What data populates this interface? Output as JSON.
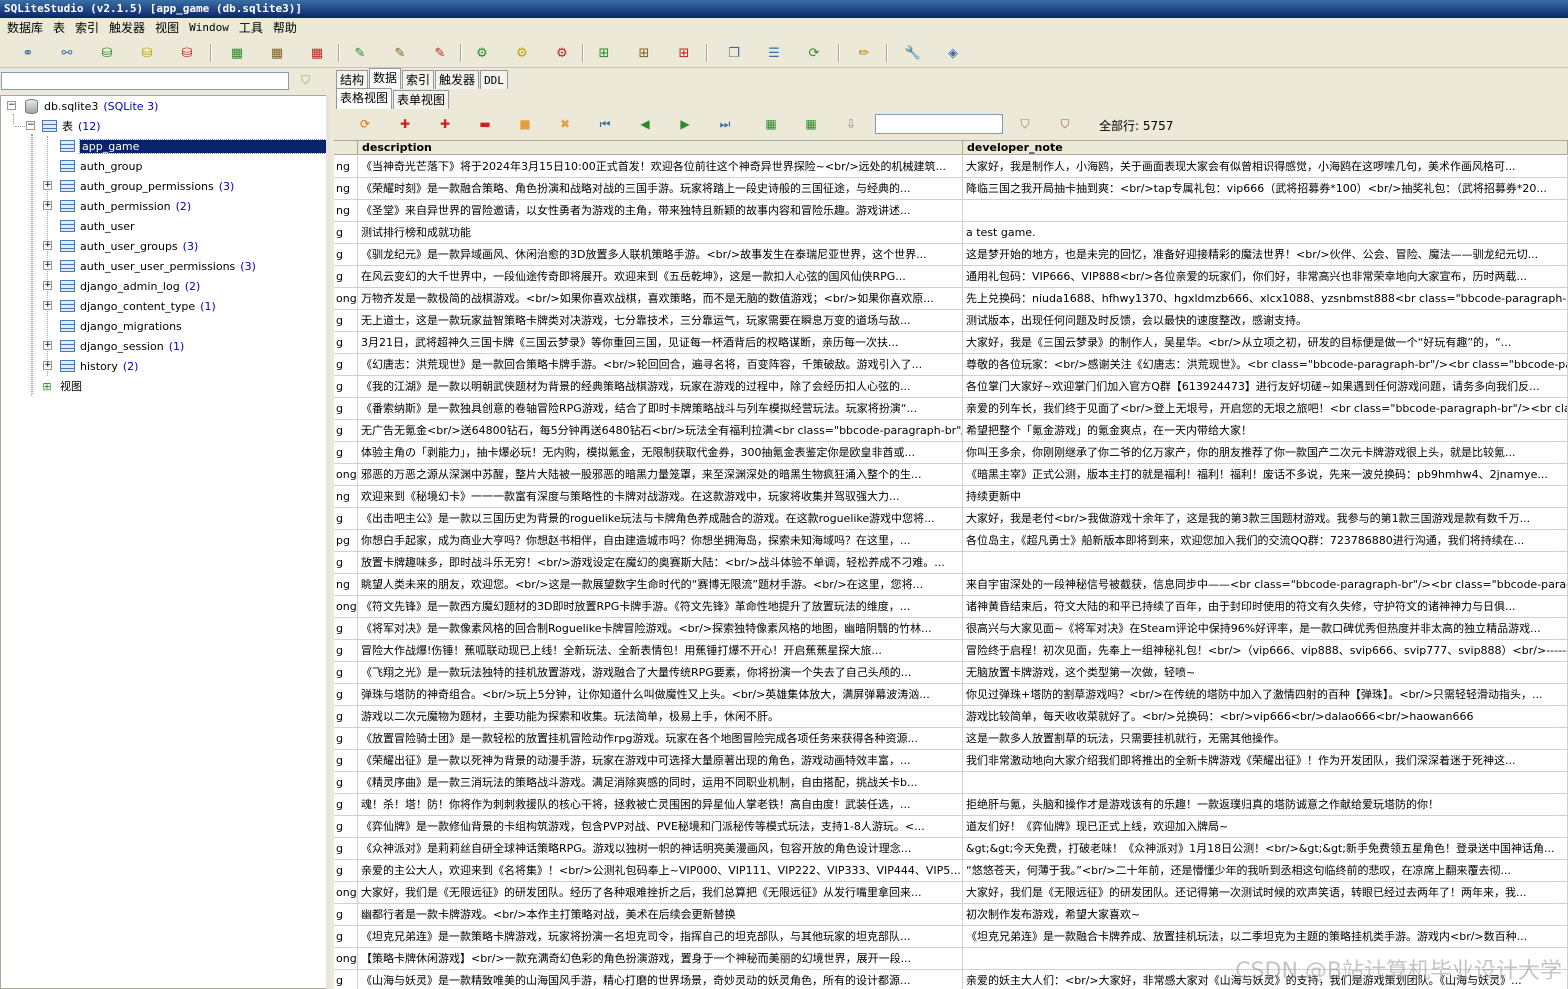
{
  "window": {
    "title": "SQLiteStudio (v2.1.5) [app_game (db.sqlite3)]"
  },
  "menu": [
    "数据库",
    "表",
    "索引",
    "触发器",
    "视图",
    "Window",
    "工具",
    "帮助"
  ],
  "tree": {
    "database": {
      "name": "db.sqlite3",
      "type": "(SQLite 3)"
    },
    "tables_group": {
      "label": "表",
      "count": "(12)"
    },
    "tables": [
      {
        "name": "app_game",
        "count": ""
      },
      {
        "name": "auth_group",
        "count": ""
      },
      {
        "name": "auth_group_permissions",
        "count": "(3)"
      },
      {
        "name": "auth_permission",
        "count": "(2)"
      },
      {
        "name": "auth_user",
        "count": ""
      },
      {
        "name": "auth_user_groups",
        "count": "(3)"
      },
      {
        "name": "auth_user_user_permissions",
        "count": "(3)"
      },
      {
        "name": "django_admin_log",
        "count": "(2)"
      },
      {
        "name": "django_content_type",
        "count": "(1)"
      },
      {
        "name": "django_migrations",
        "count": ""
      },
      {
        "name": "django_session",
        "count": "(1)"
      },
      {
        "name": "history",
        "count": "(2)"
      }
    ],
    "views_label": "视图"
  },
  "tabs": [
    "结构",
    "数据",
    "索引",
    "触发器",
    "DDL"
  ],
  "subtabs": [
    "表格视图",
    "表单视图"
  ],
  "total_rows_label": "全部行:",
  "total_rows": "5757",
  "columns": [
    "description",
    "developer_note"
  ],
  "rows": [
    [
      "ng",
      "《当神奇光芒落下》将于2024年3月15日10:00正式首发！欢迎各位前往这个神奇异世界探险~<br/>远处的机械建筑...",
      "大家好，我是制作人，小海鸥，关于画面表现大家会有似曾相识得感觉，小海鸥在这啰嗦几句，美术作画风格可..."
    ],
    [
      "ng",
      "《荣耀时刻》是一款融合策略、角色扮演和战略对战的三国手游。玩家将踏上一段史诗般的三国征途，与经典的...",
      "降临三国之我开局抽卡抽到爽：<br/>tap专属礼包：vip666（武将招募券*100）<br/>抽奖礼包：（武将招募券*20..."
    ],
    [
      "ng",
      "《圣堂》来自异世界的冒险邀请，以女性勇者为游戏的主角，带来独特且新颖的故事内容和冒险乐趣。游戏讲述...",
      ""
    ],
    [
      "g",
      "测试排行榜和成就功能",
      "a test game."
    ],
    [
      "g",
      "《驯龙纪元》是一款异域画风、休闲治愈的3D放置多人联机策略手游。<br/>故事发生在泰瑞尼亚世界，这个世界...",
      "这是梦开始的地方，也是未完的回忆，准备好迎接精彩的魔法世界！<br/>伙伴、公会、冒险、魔法——驯龙纪元切..."
    ],
    [
      "g",
      "在风云变幻的大千世界中，一段仙途传奇即将展开。欢迎来到《五岳乾坤》，这是一款扣人心弦的国风仙侠RPG...",
      "通用礼包码：VIP666、VIP888<br/>各位亲爱的玩家们，你们好，非常高兴也非常荣幸地向大家宣布，历时两载..."
    ],
    [
      "ong",
      "万物齐发是一款极简的战棋游戏。<br/>如果你喜欢战棋，喜欢策略，而不是无脑的数值游戏；<br/>如果你喜欢原...",
      "先上兑换码：niuda1688、hfhwy1370、hgxldmzb666、xlcx1088、yzsnbmst888<br class=\"bbcode-paragraph-br\"/><br clas..."
    ],
    [
      "g",
      "无上道士，这是一款玩家益智策略卡牌类对决游戏，七分靠技术，三分靠运气，玩家需要在瞬息万变的道场与敌...",
      "测试版本，出现任何问题及时反馈，会以最快的速度整改，感谢支持。"
    ],
    [
      "g",
      "3月21日，武将超神久三国卡牌《三国云梦录》等你重回三国，见证每一杯酒背后的权略谋断，亲历每一次扶...",
      "大家好，我是《三国云梦录》的制作人，吴星华。<br/>从立项之初，研发的目标便是做一个“好玩有趣”的，“..."
    ],
    [
      "g",
      "《幻唐志：洪荒现世》是一款回合策略卡牌手游。<br/>轮回回合，遍寻名将，百变阵容，千策破敌。游戏引入了...",
      "尊敬的各位玩家：<br/>感谢关注《幻唐志：洪荒现世》。<br class=\"bbcode-paragraph-br\"/><br class=\"bbcode-paragr..."
    ],
    [
      "g",
      "《我的江湖》是一款以明朝武侠题材为背景的经典策略战棋游戏，玩家在游戏的过程中，除了会经历扣人心弦的...",
      "各位掌门大家好~欢迎掌门们加入官方Q群【613924473】进行友好切磋~如果遇到任何游戏问题，请务多向我们反..."
    ],
    [
      "g",
      "《番索纳斯》是一款独具创意的卷轴冒险RPG游戏，结合了即时卡牌策略战斗与列车模拟经营玩法。玩家将扮演“...",
      "亲爱的列车长，我们终于见面了<br/>登上无垠号，开启您的无垠之旅吧！<br class=\"bbcode-paragraph-br\"/><br class..."
    ],
    [
      "g",
      "无广告无氪金<br/>送64800钻石，每5分钟再送6480钻石<br/>玩法全有福利拉满<br class=\"bbcode-paragraph-br\"/>...",
      "希望把整个「氪金游戏」的氪金爽点，在一天内带给大家！"
    ],
    [
      "g",
      "体验主角の「剥能力」，抽卡爆必玩！无内购，模拟氪金，无限制获取代金券，300抽氪金表鉴定你是欧皇非酋或...",
      "你叫王多余，你刚刚继承了你二爷的亿万家产，你的朋友推荐了你一款国产二次元卡牌游戏很上头，就是比较氪..."
    ],
    [
      "ong",
      "邪恶的万恶之源从深渊中苏醒，整片大陆被一股邪恶的暗黑力量笼罩，来至深渊深处的暗黑生物疯狂涌入整个的生...",
      "《暗黑主宰》正式公测，版本主打的就是福利！福利！福利！废话不多说，先来一波兑换码：pb9hmhw4、2jnamye..."
    ],
    [
      "ng",
      "欢迎来到《秘境幻卡》一一一款富有深度与策略性的卡牌对战游戏。在这款游戏中，玩家将收集并驾驭强大力...",
      "持续更新中"
    ],
    [
      "g",
      "《出击吧主公》是一款以三国历史为背景的roguelike玩法与卡牌角色养成融合的游戏。在这款roguelike游戏中您将...",
      "大家好，我是老付<br/>我做游戏十余年了，这是我的第3款三国题材游戏。我参与的第1款三国游戏是款有数千万..."
    ],
    [
      "pg",
      "你想白手起家，成为商业大亨吗？你想赵书相伴，自由建造城市吗？你想坐拥海岛，探索未知海域吗？在这里，...",
      "各位岛主，《超凡勇士》船新版本即将到来，欢迎您加入我们的交流QQ群：723786880进行沟通，我们将持续在..."
    ],
    [
      "g",
      "放置卡牌趣味多，即时战斗乐无穷！<br/>游戏设定在魔幻的奥赛斯大陆：<br/>战斗体验不单调，轻松养成不刁难。...",
      ""
    ],
    [
      "ng",
      "眺望人类未来的朋友，欢迎您。<br/>这是一款展望数字生命时代的“赛博无限流”题材手游。<br/>在这里，您将...",
      "来自宇宙深处的一段神秘信号被截获，信息同步中——<br class=\"bbcode-paragraph-br\"/><br class=\"bbcode-paragraph-b..."
    ],
    [
      "ong",
      "《符文先锋》是一款西方魔幻题材的3D即时放置RPG卡牌手游。《符文先锋》革命性地提升了放置玩法的维度，...",
      "诸神黄昏结束后，符文大陆的和平已持续了百年，由于封印时使用的符文有久失修，守护符文的诸神神力与日俱..."
    ],
    [
      "g",
      "《将军对决》是一款像素风格的回合制Roguelike卡牌冒险游戏。<br/>探索独特像素风格的地图，幽暗阴翳的竹林...",
      "很高兴与大家见面~《将军对决》在Steam评论中保持96%好评率，是一款口碑优秀但热度并非太高的独立精品游戏..."
    ],
    [
      "g",
      "冒险大作战爆!伤锤！蕉呱联动现已上线！全新玩法、全新表情包！用蕉锤打爆不开心！开启蕉蕉星探大旅...",
      "冒险终于启程！初次见面，先奉上一组神秘礼包！<br/>（vip666、vip888、svip666、svip777、svip888）<br/>------..."
    ],
    [
      "g",
      "《飞翔之光》是一款玩法独特的挂机放置游戏，游戏融合了大量传统RPG要素，你将扮演一个失去了自己头颅的...",
      "无脑放置卡牌游戏，这个类型第一次做，轻喷~"
    ],
    [
      "g",
      "弹珠与塔防的神奇组合。<br/>玩上5分钟，让你知道什么叫做魔性又上头。<br/>英雄集体放大，满屏弹幕波涛汹...",
      "你见过弹珠+塔防的割草游戏吗？<br/>在传统的塔防中加入了激情四射的百种【弹珠】。<br/>只需轻轻滑动指头，..."
    ],
    [
      "g",
      "游戏以二次元魔物为题材，主要功能为探索和收集。玩法简单，极易上手，休闲不肝。",
      "游戏比较简单，每天收收菜就好了。<br/>兑换码：<br/>vip666<br/>dalao666<br/>haowan666"
    ],
    [
      "g",
      "《放置冒险骑士团》是一款轻松的放置挂机冒险动作rpg游戏。玩家在各个地图冒险完成各项任务来获得各种资源...",
      "这是一款多人放置割草的玩法，只需要挂机就行，无需其他操作。"
    ],
    [
      "g",
      "《荣耀出征》是一款以死神为背景的动漫手游，玩家在游戏中可选择大量原著出现的角色，游戏动画特效丰富，...",
      "我们非常激动地向大家介绍我们即将推出的全新卡牌游戏《荣耀出征》！作为开发团队，我们深深着迷于死神这..."
    ],
    [
      "g",
      "《精灵序曲》是一款三消玩法的策略战斗游戏。满足消除爽感的同时，运用不同职业机制，自由搭配，挑战关卡b...",
      ""
    ],
    [
      "g",
      "魂！杀！塔！防！你将作为刺刺救援队的核心干将，拯救被亡灵围困的异星仙人掌老铁！高自由度！武装任选，...",
      "拒绝肝与氪，头脑和操作才是游戏该有的乐趣！一款返璞归真的塔防诚意之作献给爱玩塔防的你！"
    ],
    [
      "g",
      "《弈仙牌》是一款修仙背景的卡组构筑游戏，包含PVP对战、PVE秘境和门派秘传等模式玩法，支持1-8人游玩。<...",
      "道友们好！《弈仙牌》现已正式上线，欢迎加入牌局~"
    ],
    [
      "g",
      "《众神派对》是莉莉丝自研全球神话策略RPG。游戏以独树一帜的神话明亮美漫画风，包容开放的角色设计理念...",
      "&gt;&gt;今天免费，打破老味！《众神派对》1月18日公测！<br/>&gt;&gt;新手免费领五星角色！登录送中国神话角..."
    ],
    [
      "g",
      "亲爱的主公大人，欢迎来到《名将集》！<br/>公测礼包码奉上~VIP000、VIP111、VIP222、VIP333、VIP444、VIP5...",
      "“悠悠苍天，何薄于我。”<br/>二十年前，还是懵懂少年的我听到丞相这句临终前的悲叹，在凉席上翻来覆去彻..."
    ],
    [
      "ong",
      "大家好，我们是《无限远征》的研发团队。经历了各种艰难挫折之后，我们总算把《无限远征》从发行嘴里拿回来...",
      "大家好，我们是《无限远征》的研发团队。还记得第一次测试时候的欢声笑语，转眼已经过去两年了！两年来，我..."
    ],
    [
      "g",
      "幽都行者是一款卡牌游戏。<br/>本作主打策略对战，美术在后续会更新替换",
      "初次制作发布游戏，希望大家喜欢~"
    ],
    [
      "g",
      "《坦克兄弟连》是一款策略卡牌游戏，玩家将扮演一名坦克司令，指挥自己的坦克部队，与其他玩家的坦克部队...",
      "《坦克兄弟连》是一款融合卡牌养成、放置挂机玩法，以二季坦克为主题的策略挂机类手游。游戏内<br/>数百种..."
    ],
    [
      "ong",
      "【策略卡牌休闲游戏】<br/>一款充满奇幻色彩的角色扮演游戏，置身于一个神秘而美丽的幻境世界，展开一段...",
      ""
    ],
    [
      "g",
      "《山海与妖灵》是一款精致唯美的山海国风手游，精心打磨的世界场景，奇妙灵动的妖灵角色，所有的设计都源...",
      "亲爱的妖主大人们：<br/>大家好，非常感大家对《山海与妖灵》的支持，我们是游戏策划团队。《山海与妖灵》..."
    ]
  ],
  "watermark": "CSDN @B站计算机毕业设计大学"
}
